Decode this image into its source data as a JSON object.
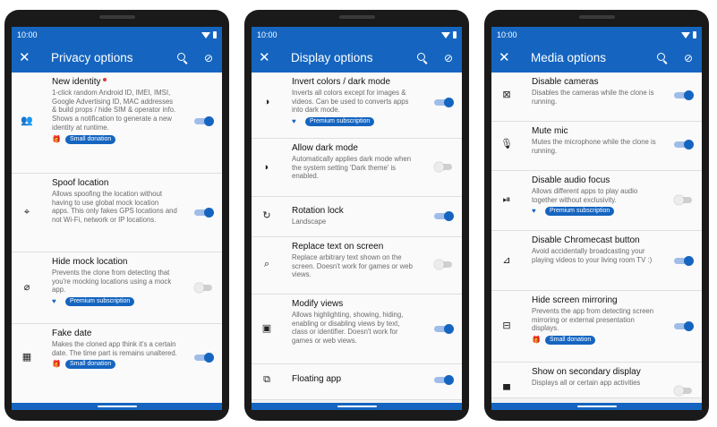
{
  "screens": [
    {
      "time": "10:00",
      "title": "Privacy options",
      "items": [
        {
          "title": "New identity",
          "desc": "1-click random Android ID, IMEI, IMSI, Google Advertising ID, MAC addresses & build props / hide SIM & operator info. Shows a notification to generate a new identity at runtime.",
          "badge": "Small donation",
          "on": true
        },
        {
          "title": "Spoof location",
          "desc": "Allows spoofing the location without having to use global mock location apps. This only fakes GPS locations and not Wi-Fi, network or IP locations.",
          "badge": "",
          "on": true
        },
        {
          "title": "Hide mock location",
          "desc": "Prevents the clone from detecting that you're mocking locations using a mock app.",
          "badge": "Premium subscription",
          "on": false
        },
        {
          "title": "Fake date",
          "desc": "Makes the cloned app think it's a certain date. The time part is remains unaltered.",
          "badge": "Small donation",
          "on": true
        }
      ]
    },
    {
      "time": "10:00",
      "title": "Display options",
      "items": [
        {
          "title": "Invert colors / dark mode",
          "desc": "Inverts all colors except for images & videos. Can be used to converts apps into dark mode.",
          "badge": "Premium subscription",
          "on": true
        },
        {
          "title": "Allow dark mode",
          "desc": "Automatically applies dark mode when the system setting 'Dark theme' is enabled.",
          "badge": "",
          "on": false
        },
        {
          "title": "Rotation lock",
          "desc": "Landscape",
          "badge": "",
          "on": true
        },
        {
          "title": "Replace text on screen",
          "desc": "Replace arbitrary text shown on the screen. Doesn't work for games or web views.",
          "badge": "",
          "on": false
        },
        {
          "title": "Modify views",
          "desc": "Allows highlighting, showing, hiding, enabling or disabling views by text, class or identifier. Doesn't work for games or web views.",
          "badge": "",
          "on": true
        },
        {
          "title": "Floating app",
          "desc": "",
          "badge": "",
          "on": true
        }
      ]
    },
    {
      "time": "10:00",
      "title": "Media options",
      "items": [
        {
          "title": "Disable cameras",
          "desc": "Disables the cameras while the clone is running.",
          "badge": "",
          "on": true
        },
        {
          "title": "Mute mic",
          "desc": "Mutes the microphone while the clone is running.",
          "badge": "",
          "on": true
        },
        {
          "title": "Disable audio focus",
          "desc": "Allows different apps to play audio together without exclusivity.",
          "badge": "Premium subscription",
          "on": false
        },
        {
          "title": "Disable Chromecast button",
          "desc": "Avoid accidentally broadcasting your playing videos to your living room TV :)",
          "badge": "",
          "on": true
        },
        {
          "title": "Hide screen mirroring",
          "desc": "Prevents the app from detecting screen mirroring or external presentation displays.",
          "badge": "Small donation",
          "on": true
        },
        {
          "title": "Show on secondary display",
          "desc": "Displays all or certain app activities",
          "badge": "",
          "on": false
        }
      ]
    }
  ],
  "icons": {
    "close": "close-icon",
    "search": "search-icon",
    "filter": "filter-off-icon",
    "donation": "gift-icon",
    "premium": "heart-icon"
  },
  "colors": {
    "primary": "#1565c0",
    "badge": "#1565c0",
    "new_dot": "#e53935",
    "toggle_track_on": "#9fbde8",
    "background": "#f2f2f2"
  }
}
